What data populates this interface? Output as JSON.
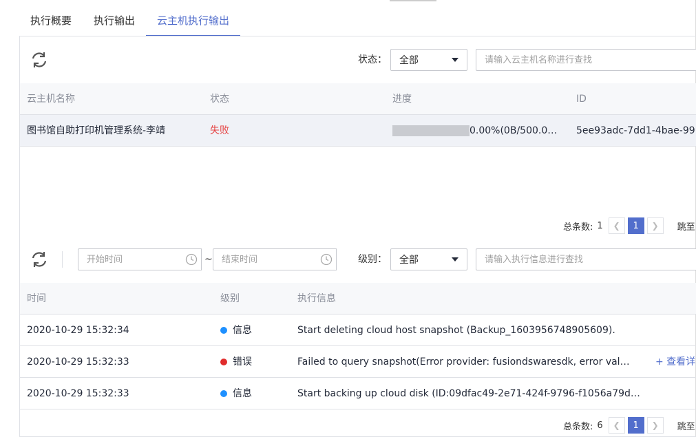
{
  "tabs": [
    {
      "label": "执行概要"
    },
    {
      "label": "执行输出"
    },
    {
      "label": "云主机执行输出"
    }
  ],
  "vm_section": {
    "status_label": "状态：",
    "status_value": "全部",
    "search_placeholder": "请输入云主机名称进行查找",
    "columns": [
      "云主机名称",
      "状态",
      "进度",
      "ID"
    ],
    "rows": [
      {
        "name": "图书馆自助打印机管理系统-李靖",
        "status": "失败",
        "progress": 0.0,
        "progress_text": "0.00%(0B/500.0…",
        "id": "5ee93adc-7dd1-4bae-99"
      }
    ],
    "total_label": "总条数:",
    "total": "1",
    "page": "1",
    "jump_label": "跳至"
  },
  "log_section": {
    "start_placeholder": "开始时间",
    "tilde": "~",
    "end_placeholder": "结束时间",
    "level_label": "级别：",
    "level_value": "全部",
    "search_placeholder": "请输入执行信息进行查找",
    "columns": [
      "时间",
      "级别",
      "执行信息"
    ],
    "rows": [
      {
        "time": "2020-10-29 15:32:34",
        "level": "信息",
        "message": "Start deleting cloud host snapshot (Backup_1603956748905609).",
        "more": ""
      },
      {
        "time": "2020-10-29 15:32:33",
        "level": "错误",
        "message": "Failed to query snapshot(Error provider: fusiondswaresdk, error val…",
        "more": "+ 查看详"
      },
      {
        "time": "2020-10-29 15:32:33",
        "level": "信息",
        "message": "Start backing up cloud disk (ID:09dfac49-2e71-424f-9796-f1056a79d…",
        "more": ""
      }
    ],
    "total_label": "总条数:",
    "total": "6",
    "page": "1",
    "jump_label": "跳至"
  },
  "colors": {
    "accent": "#526ecc",
    "fail": "#e54545",
    "info_dot": "#1e90ff",
    "error_dot": "#e02c2c"
  },
  "icons": [
    "refresh-icon",
    "chevron-left-icon",
    "chevron-right-icon",
    "clock-icon",
    "caret-down-icon"
  ]
}
